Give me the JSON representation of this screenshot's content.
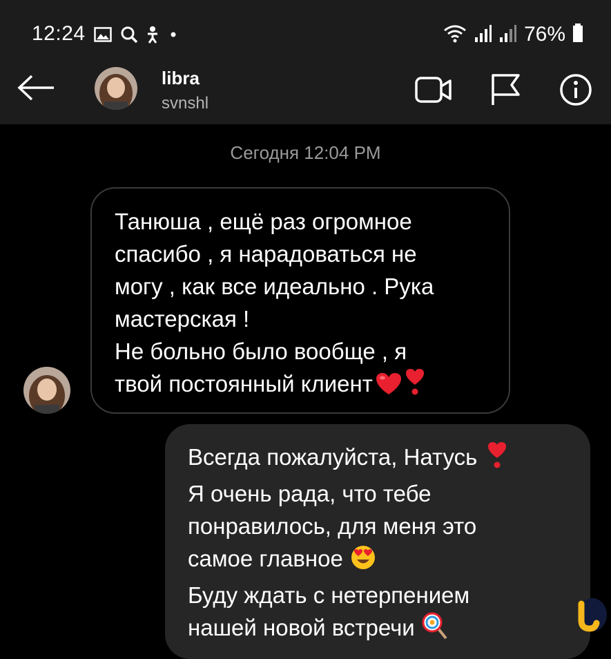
{
  "status_bar": {
    "time": "12:24",
    "battery": "76%",
    "left_icons": [
      "image-icon",
      "search-icon",
      "accessibility-icon",
      "dot-icon"
    ],
    "right_icons": [
      "wifi-icon",
      "signal-icon",
      "signal-icon",
      "battery-icon"
    ]
  },
  "header": {
    "name": "libra",
    "username": "svnshl",
    "actions": [
      "video-call-icon",
      "flag-icon",
      "info-icon"
    ]
  },
  "conversation": {
    "timestamp": "Сегодня 12:04 PM",
    "messages": [
      {
        "direction": "incoming",
        "lines": [
          "Танюша , ещё раз огромное",
          "спасибо , я нарадоваться не",
          "могу , как все идеально . Рука",
          "мастерская !",
          "Не больно было вообще , я",
          "твой постоянный клиент"
        ],
        "trailing_emojis": [
          "red-heart-icon",
          "heart-exclamation-icon"
        ]
      },
      {
        "direction": "outgoing",
        "lines": [
          "Всегда пожалуйста, Натусь",
          "Я очень рада, что тебе",
          "понравилось, для меня это",
          "самое главное",
          "Буду ждать с нетерпением",
          "нашей новой встречи"
        ],
        "inline_emojis": [
          "heart-exclamation-icon",
          "heart-eyes-icon",
          "lollipop-icon"
        ]
      }
    ]
  },
  "colors": {
    "background": "#000000",
    "bars": "#1c1c1c",
    "outgoing_bubble": "#262626",
    "incoming_border": "#3a3a3a",
    "secondary_text": "#9a9a9a"
  }
}
